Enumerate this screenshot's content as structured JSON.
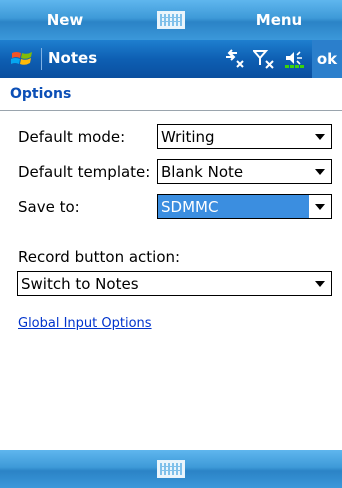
{
  "softkeys": {
    "left_label": "New",
    "right_label": "Menu"
  },
  "titlebar": {
    "app_title": "Notes",
    "ok_label": "ok"
  },
  "page": {
    "header": "Options"
  },
  "form": {
    "default_mode": {
      "label": "Default mode:",
      "value": "Writing"
    },
    "default_template": {
      "label": "Default template:",
      "value": "Blank Note"
    },
    "save_to": {
      "label": "Save to:",
      "value": "SDMMC"
    },
    "record_button_action": {
      "label": "Record button action:",
      "value": "Switch to Notes"
    }
  },
  "links": {
    "global_input_options": "Global Input Options"
  },
  "colors": {
    "softbar": "#3e9ad8",
    "titlebar": "#0e5fb3",
    "header_text": "#0c4fb6",
    "selection": "#3b8ee0",
    "link": "#0033cc"
  },
  "icons": [
    "keyboard-icon",
    "windows-start-icon",
    "connectivity-icon",
    "signal-off-icon",
    "volume-icon",
    "battery-icon"
  ]
}
